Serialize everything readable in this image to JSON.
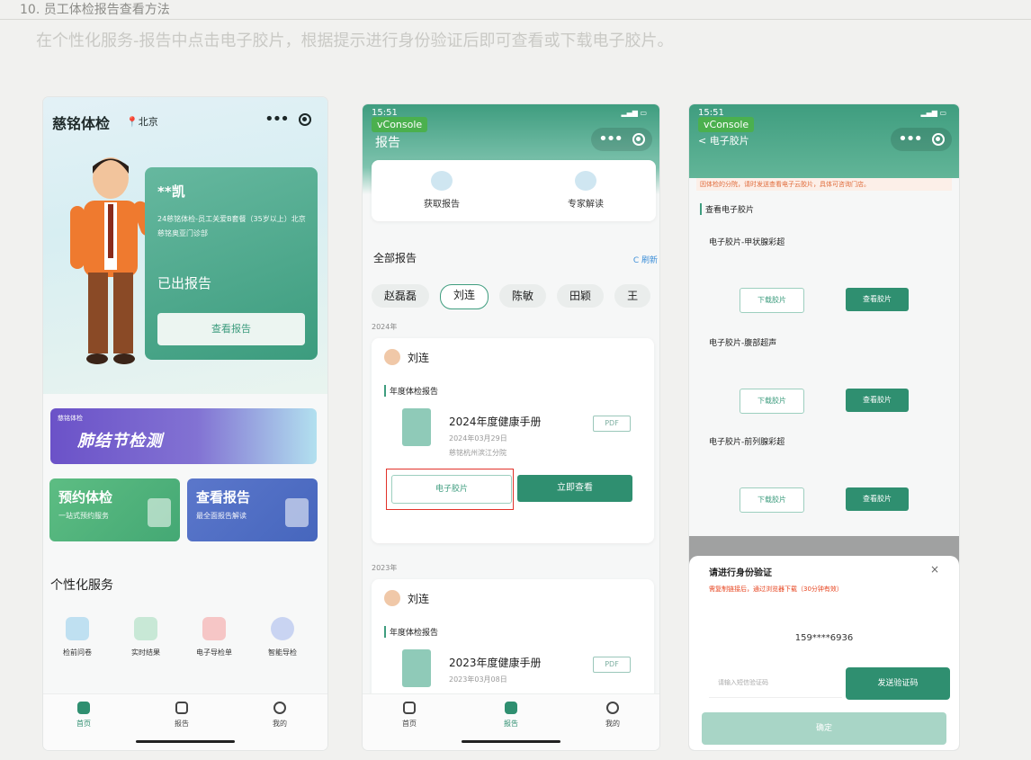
{
  "doc": {
    "header": "10. 员工体检报告查看方法",
    "bg_text": "在个性化服务-报告中点击电子胶片，根据提示进行身份验证后即可查看或下载电子胶片。"
  },
  "phone1": {
    "app_title": "慈铭体检",
    "location": "北京",
    "capsule_dots": "•••",
    "card": {
      "name": "**凯",
      "desc": "24慈铭体检-员工关爱B套餐（35岁以上）北京慈铭奥亚门诊部",
      "status": "已出报告",
      "button": "查看报告"
    },
    "banner": {
      "logo": "慈铭体检",
      "title": "肺结节检测"
    },
    "tiles": [
      {
        "title": "预约体检",
        "sub": "一站式预约服务"
      },
      {
        "title": "查看报告",
        "sub": "最全面报告解读"
      }
    ],
    "section": "个性化服务",
    "services": [
      "检前问卷",
      "实时结果",
      "电子导检单",
      "智能导检"
    ],
    "tabs": [
      "首页",
      "报告",
      "我的"
    ]
  },
  "phone2": {
    "time": "15:51",
    "vconsole": "vConsole",
    "header": "报告",
    "quick": [
      "获取报告",
      "专家解读"
    ],
    "all_reports": "全部报告",
    "refresh": "C 刷新",
    "people": [
      "赵磊磊",
      "刘连",
      "陈敏",
      "田颖",
      "王"
    ],
    "reports": [
      {
        "year": "2024年",
        "person": "刘连",
        "kind": "年度体检报告",
        "book": "2024年度健康手册",
        "date": "2024年03月29日",
        "hospital": "慈铭杭州滨江分院",
        "pdf": "PDF",
        "film_btn": "电子胶片",
        "view_btn": "立即查看"
      },
      {
        "year": "2023年",
        "person": "刘连",
        "kind": "年度体检报告",
        "book": "2023年度健康手册",
        "date": "2023年03月08日",
        "pdf": "PDF"
      }
    ],
    "tabs": [
      "首页",
      "报告",
      "我的"
    ]
  },
  "phone3": {
    "time": "15:51",
    "vconsole": "vConsole",
    "header": "< 电子胶片",
    "warning": "因体检的分院，请时发送查看电子云胶片，具体可咨询门店。",
    "section": "查看电子胶片",
    "films": [
      "电子胶片-甲状腺彩超",
      "电子胶片-腹部超声",
      "电子胶片-前列腺彩超"
    ],
    "download": "下载胶片",
    "view": "查看胶片",
    "dialog": {
      "title": "请进行身份验证",
      "close": "×",
      "warn": "需复制链接后，通过浏览器下载（30分钟有效）",
      "phone": "159****6936",
      "input_placeholder": "请输入短信验证码",
      "send": "发送验证码",
      "confirm": "确定"
    }
  }
}
